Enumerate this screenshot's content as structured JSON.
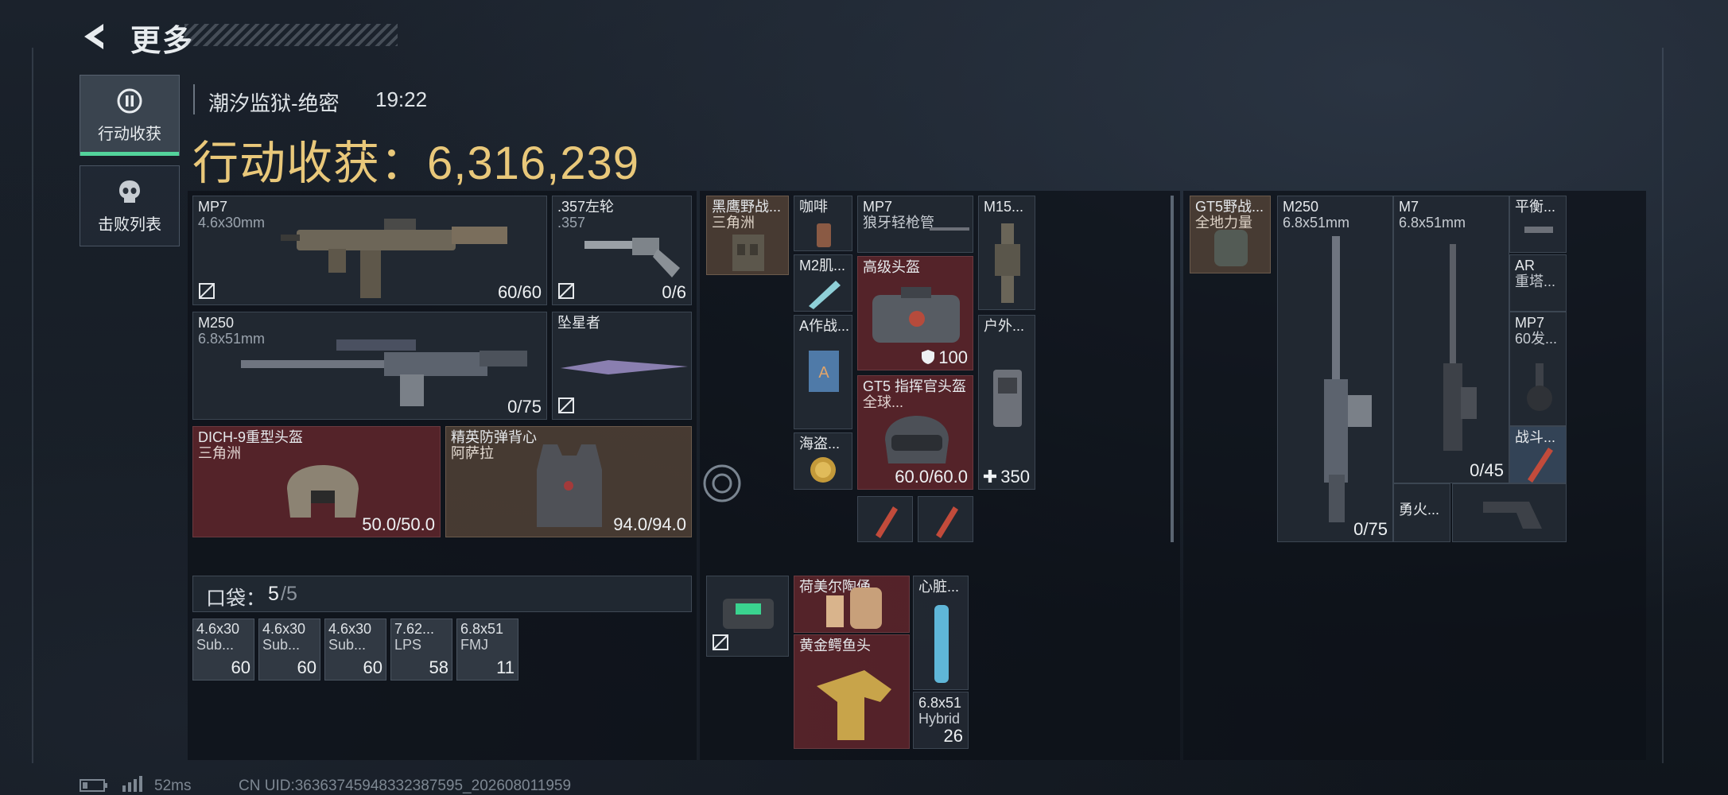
{
  "header": {
    "title": "更多"
  },
  "sidebar": {
    "tabs": [
      {
        "label": "行动收获",
        "active": true
      },
      {
        "label": "击败列表",
        "active": false
      }
    ]
  },
  "info": {
    "map": "潮汐监狱-绝密",
    "time": "19:22",
    "haul_label": "行动收获：",
    "haul_value": "6,316,239"
  },
  "loadout": {
    "primary": {
      "name": "MP7",
      "sub": "4.6x30mm",
      "ammo": "60/60"
    },
    "sidearm": {
      "name": ".357左轮",
      "sub": ".357",
      "ammo": "0/6"
    },
    "secondary": {
      "name": "M250",
      "sub": "6.8x51mm",
      "ammo": "0/75"
    },
    "melee": {
      "name": "坠星者"
    },
    "helmet": {
      "name": "DICH-9重型头盔",
      "sub": "三角洲",
      "durability": "50.0/50.0"
    },
    "armor": {
      "name": "精英防弹背心",
      "sub": "阿萨拉",
      "durability": "94.0/94.0"
    }
  },
  "pocket": {
    "label": "口袋：",
    "count": "5",
    "capacity": "/5",
    "items": [
      {
        "name": "4.6x30",
        "sub": "Sub...",
        "qty": "60"
      },
      {
        "name": "4.6x30",
        "sub": "Sub...",
        "qty": "60"
      },
      {
        "name": "4.6x30",
        "sub": "Sub...",
        "qty": "60"
      },
      {
        "name": "7.62...",
        "sub": "LPS",
        "qty": "58"
      },
      {
        "name": "6.8x51",
        "sub": "FMJ",
        "qty": "11"
      }
    ]
  },
  "rig": {
    "chest": {
      "name": "黑鹰野战...",
      "sub": "三角洲"
    },
    "coffee": {
      "name": "咖啡"
    },
    "mp7_barrel": {
      "name": "MP7",
      "sub": "狼牙轻枪管"
    },
    "m15": {
      "name": "M15..."
    },
    "m2": {
      "name": "M2肌..."
    },
    "adv_helmet": {
      "name": "高级头盔",
      "value": "100"
    },
    "a_card": {
      "name": "A作战..."
    },
    "outdoor": {
      "name": "户外...",
      "value": "350"
    },
    "gt5_helmet": {
      "name": "GT5 指挥官头盔",
      "sub": "全球...",
      "durability": "60.0/60.0"
    },
    "pirate": {
      "name": "海盗..."
    }
  },
  "backpack_slot": {},
  "case": {
    "jar": {
      "name": "荷美尔陶俑"
    },
    "heart": {
      "name": "心脏..."
    },
    "croc": {
      "name": "黄金鳄鱼头"
    },
    "ammo": {
      "name": "6.8x51",
      "sub": "Hybrid",
      "qty": "26"
    }
  },
  "backpack": {
    "bag": {
      "name": "GT5野战...",
      "sub": "全地力量"
    },
    "m250": {
      "name": "M250",
      "sub": "6.8x51mm",
      "ammo": "0/75"
    },
    "m7": {
      "name": "M7",
      "sub": "6.8x51mm",
      "ammo": "0/45"
    },
    "balance": {
      "name": "平衡..."
    },
    "ar": {
      "name": "AR",
      "sub": "重塔..."
    },
    "mp7_mag": {
      "name": "MP7",
      "sub": "60发..."
    },
    "combat": {
      "name": "战斗..."
    },
    "brave": {
      "name": "勇火..."
    }
  },
  "status_bar": {
    "ping": "52ms",
    "uid": "CN UID:3636374594833238​7595_202608011959"
  },
  "colors": {
    "accent_green": "#53d39b",
    "gold": "#e9c87a",
    "red_slot": "#60262c",
    "brown_slot": "#4e4036"
  }
}
